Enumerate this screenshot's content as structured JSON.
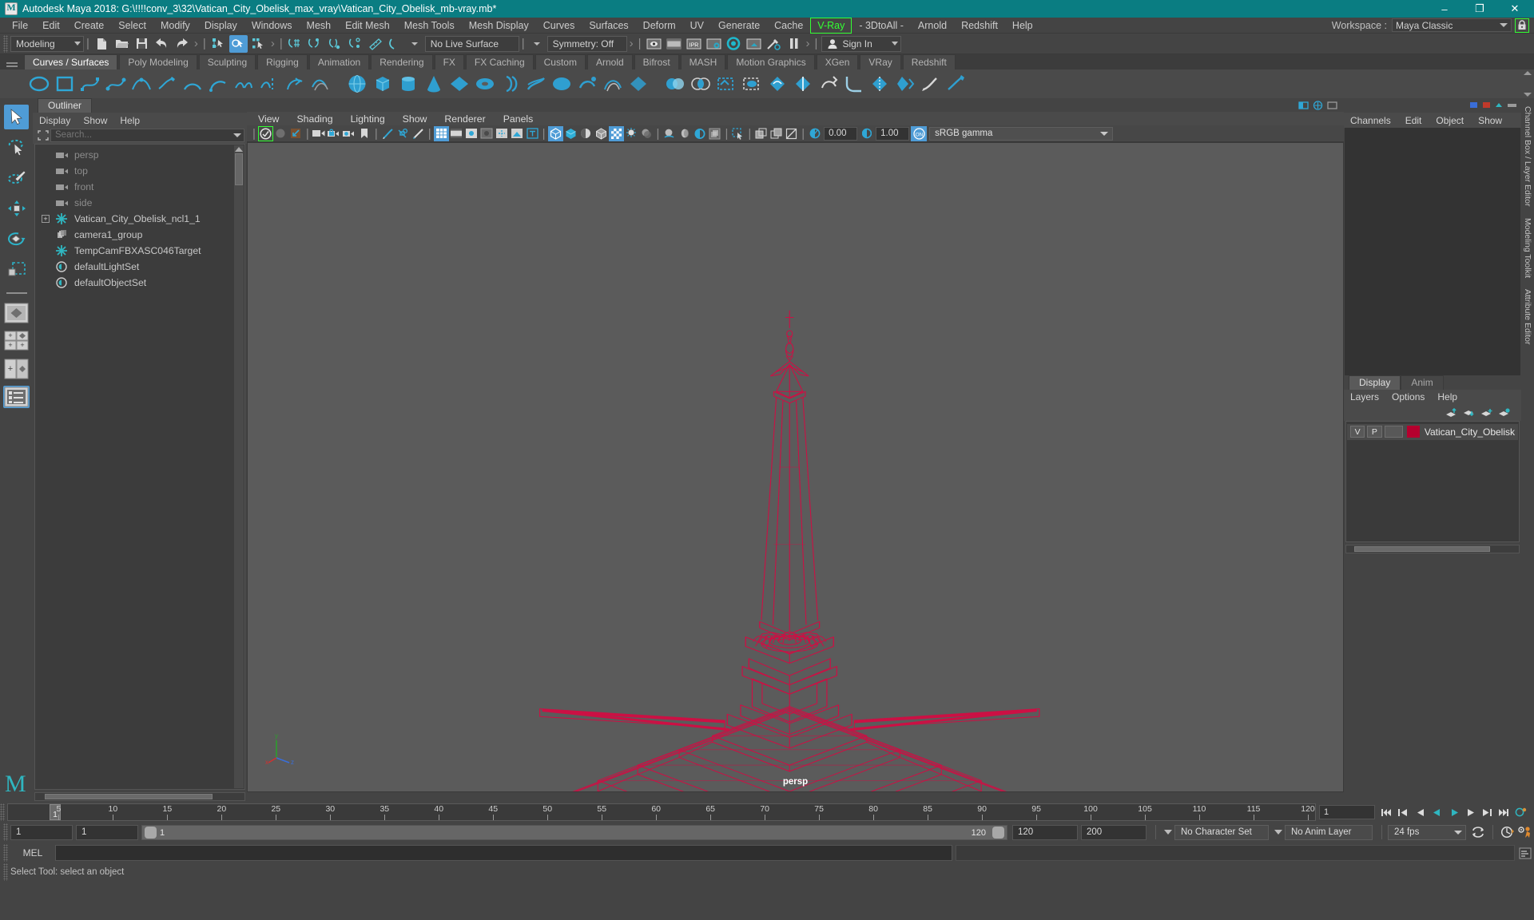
{
  "titlebar": {
    "title": "Autodesk Maya 2018: G:\\!!!!conv_3\\32\\Vatican_City_Obelisk_max_vray\\Vatican_City_Obelisk_mb-vray.mb*",
    "minimize": "–",
    "maximize": "❐",
    "close": "✕"
  },
  "menubar": {
    "items": [
      "File",
      "Edit",
      "Create",
      "Select",
      "Modify",
      "Display",
      "Windows",
      "Mesh",
      "Edit Mesh",
      "Mesh Tools",
      "Mesh Display",
      "Curves",
      "Surfaces",
      "Deform",
      "UV",
      "Generate",
      "Cache",
      "V-Ray",
      "- 3DtoAll -",
      "Arnold",
      "Redshift",
      "Help"
    ],
    "highlighted": "V-Ray",
    "workspace_label": "Workspace :",
    "workspace_value": "Maya Classic",
    "lock_icon": "lock-icon"
  },
  "statusline": {
    "menuset": "Modeling",
    "live_surface": "No Live Surface",
    "symmetry": "Symmetry: Off",
    "signin": "Sign In"
  },
  "shelf": {
    "tabs": [
      "Curves / Surfaces",
      "Poly Modeling",
      "Sculpting",
      "Rigging",
      "Animation",
      "Rendering",
      "FX",
      "FX Caching",
      "Custom",
      "Arnold",
      "Bifrost",
      "MASH",
      "Motion Graphics",
      "XGen",
      "VRay",
      "Redshift"
    ],
    "active_tab": "Curves / Surfaces"
  },
  "toolbox": {
    "items": [
      "select-tool",
      "lasso-select-tool",
      "paint-select-tool",
      "move-tool",
      "rotate-tool",
      "scale-tool",
      "last-tool",
      "single-perspective-layout",
      "four-view-layout",
      "persp-outliner-layout",
      "persp-graph-layout"
    ],
    "selected": "select-tool"
  },
  "outliner": {
    "tab": "Outliner",
    "menus": [
      "Display",
      "Show",
      "Help"
    ],
    "search_placeholder": "Search...",
    "nodes": [
      {
        "label": "persp",
        "icon": "camera-icon",
        "dim": true,
        "expandable": false
      },
      {
        "label": "top",
        "icon": "camera-icon",
        "dim": true,
        "expandable": false
      },
      {
        "label": "front",
        "icon": "camera-icon",
        "dim": true,
        "expandable": false
      },
      {
        "label": "side",
        "icon": "camera-icon",
        "dim": true,
        "expandable": false
      },
      {
        "label": "Vatican_City_Obelisk_ncl1_1",
        "icon": "transform-icon",
        "dim": false,
        "expandable": true
      },
      {
        "label": "camera1_group",
        "icon": "group-icon",
        "dim": false,
        "expandable": false
      },
      {
        "label": "TempCamFBXASC046Target",
        "icon": "transform-icon",
        "dim": false,
        "expandable": false
      },
      {
        "label": "defaultLightSet",
        "icon": "set-icon",
        "dim": false,
        "expandable": false
      },
      {
        "label": "defaultObjectSet",
        "icon": "set-icon",
        "dim": false,
        "expandable": false
      }
    ]
  },
  "viewport": {
    "menus": [
      "View",
      "Shading",
      "Lighting",
      "Show",
      "Renderer",
      "Panels"
    ],
    "exposure": "0.00",
    "gamma_value": "1.00",
    "color_management": "sRGB gamma",
    "camera_label": "persp",
    "axis": {
      "x": "x",
      "y": "y",
      "z": "z"
    },
    "wireframe_color": "#cc1044"
  },
  "channelbox": {
    "tab_label": "Channel Box / Layer Editor",
    "menus": [
      "Channels",
      "Edit",
      "Object",
      "Show"
    ]
  },
  "right_tabs": [
    "Channel Box / Layer Editor",
    "Modeling Toolkit",
    "Attribute Editor"
  ],
  "layereditor": {
    "tabs": [
      "Display",
      "Anim"
    ],
    "active_tab": "Display",
    "menus": [
      "Layers",
      "Options",
      "Help"
    ],
    "buttons": [
      "move-layer-up-icon",
      "move-layer-down-icon",
      "new-layer-icon",
      "new-layer-from-selected-icon"
    ],
    "layers": [
      {
        "visible": "V",
        "playback": "P",
        "color": "#b5002e",
        "name": "Vatican_City_Obelisk"
      }
    ]
  },
  "timeslider": {
    "current_frame": "1",
    "ticks": [
      5,
      10,
      15,
      20,
      25,
      30,
      35,
      40,
      45,
      50,
      55,
      60,
      65,
      70,
      75,
      80,
      85,
      90,
      95,
      100,
      105,
      110,
      115,
      120
    ],
    "start": 1,
    "end": 120,
    "frame_field": "1"
  },
  "rangeslider": {
    "anim_start": "1",
    "range_start": "1",
    "bar_start_label": "1",
    "bar_end_label": "120",
    "range_end": "120",
    "anim_end": "200",
    "character_set": "No Character Set",
    "anim_layer": "No Anim Layer",
    "fps": "24 fps"
  },
  "melbar": {
    "label": "MEL",
    "command": ""
  },
  "statusbar": {
    "message": "Select Tool: select an object"
  }
}
